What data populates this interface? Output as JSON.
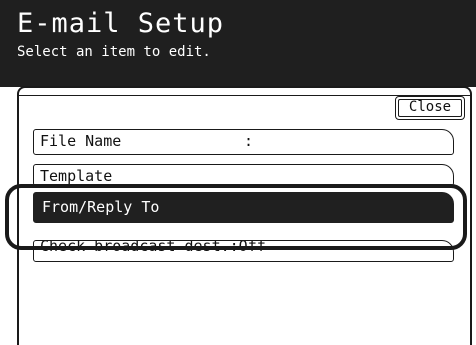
{
  "header": {
    "title": "E-mail Setup",
    "subtitle": "Select an item to edit."
  },
  "panel": {
    "close_label": "Close",
    "items": [
      {
        "label": "File Name",
        "value": ":"
      },
      {
        "label": "Template"
      },
      {
        "label": "From/Reply To",
        "selected": true
      },
      {
        "label": "Check broadcast dest.:Off"
      }
    ]
  },
  "colors": {
    "header_bg": "#1f1f1f",
    "selected_bg": "#202020",
    "text_light": "#ffffff",
    "text_dark": "#111111"
  }
}
